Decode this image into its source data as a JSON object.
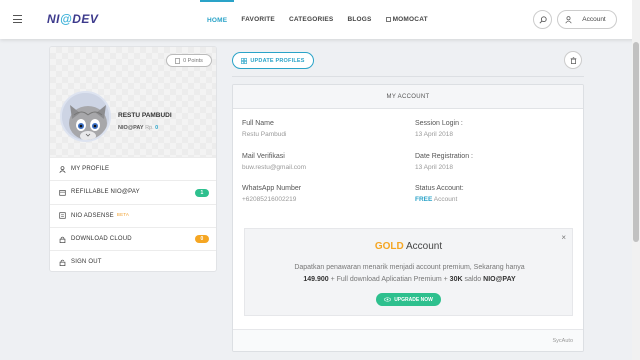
{
  "header": {
    "logo_prefix": "NI",
    "logo_at": "@",
    "logo_suffix": "DEV",
    "nav": [
      "HOME",
      "FAVORITE",
      "CATEGORIES",
      "BLOGS",
      "MOMOCAT"
    ],
    "account_label": "Account"
  },
  "profile": {
    "points": "0 Points",
    "name": "RESTU PAMBUDI",
    "balance_label": "NIO@PAY",
    "balance_currency": "Rp.",
    "balance_value": "0"
  },
  "menu": {
    "my_profile": "MY PROFILE",
    "refillable": "REFILLABLE NIO@PAY",
    "refillable_count": "1",
    "adsense": "NIO ADSENSE",
    "adsense_tag": "BETA",
    "download": "DOWNLOAD CLOUD",
    "download_count": "0",
    "signout": "SIGN OUT"
  },
  "actions": {
    "update_profiles": "UPDATE PROFILES"
  },
  "account": {
    "header": "MY ACCOUNT",
    "full_name_label": "Full Name",
    "full_name": "Restu Pambudi",
    "session_label": "Session Login :",
    "session_value": "13 April 2018",
    "email_label": "Mail Verifikasi",
    "email_value": "buw.restu@gmail.com",
    "registration_label": "Date Registration :",
    "registration_value": "13 April 2018",
    "whatsapp_label": "WhatsApp Number",
    "whatsapp_value": "+62085216002219",
    "status_label": "Status Account:",
    "status_free": "FREE",
    "status_suffix": "Account"
  },
  "gold": {
    "title_highlight": "GOLD",
    "title_rest": "Account",
    "text1": "Dapatkan penawaran menarik menjadi account premium, Sekarang hanya",
    "price": "149.900",
    "text2": "+ Full download Aplicatian Premium +",
    "bonus": "30K",
    "text3": "saldo",
    "niopay": "NIO@PAY",
    "upgrade": "UPGRADE NOW"
  },
  "footer": {
    "brand": "SycAuto"
  }
}
